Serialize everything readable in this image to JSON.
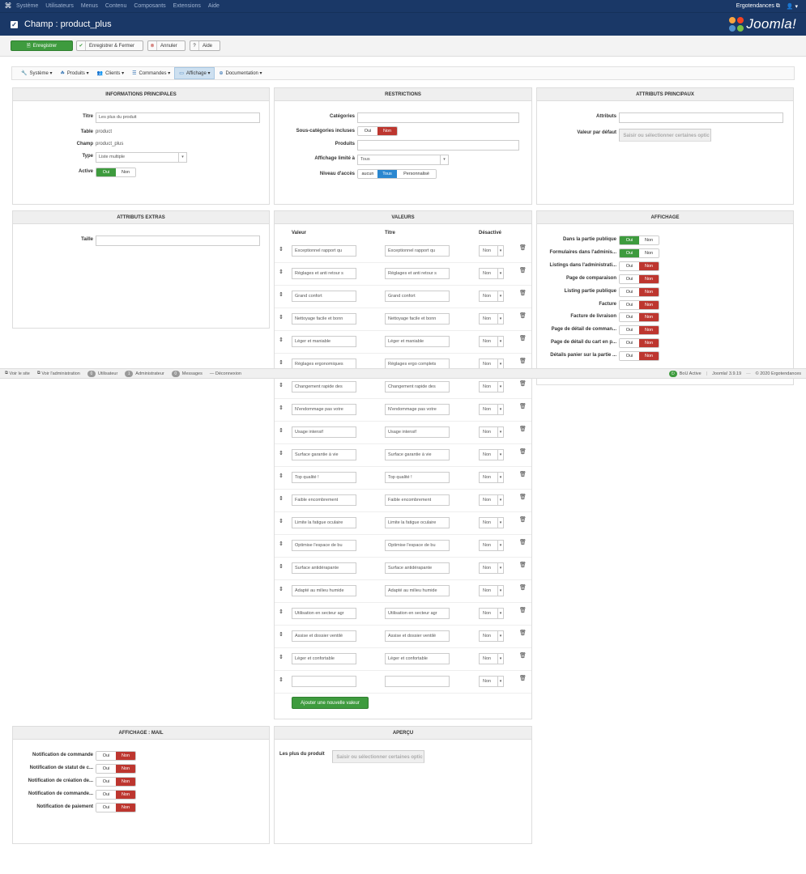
{
  "topnav": {
    "logo": "⌘",
    "items": [
      "Système",
      "Utilisateurs",
      "Menus",
      "Contenu",
      "Composants",
      "Extensions",
      "Aide"
    ],
    "site": "Ergotendances ⧉",
    "user": "👤 ▾"
  },
  "header": {
    "title": "Champ : product_plus",
    "brand": "Joomla!"
  },
  "toolbar": {
    "save": "Enregistrer",
    "save_close": "Enregistrer & Fermer",
    "cancel": "Annuler",
    "help": "Aide"
  },
  "menubar": [
    {
      "icon": "🔧",
      "label": "Système ▾"
    },
    {
      "icon": "☘",
      "label": "Produits ▾"
    },
    {
      "icon": "👥",
      "label": "Clients ▾"
    },
    {
      "icon": "☰",
      "label": "Commandes ▾"
    },
    {
      "icon": "▭",
      "label": "Affichage ▾"
    },
    {
      "icon": "⊕",
      "label": "Documentation ▾"
    }
  ],
  "info": {
    "heading": "INFORMATIONS PRINCIPALES",
    "titre_label": "Titre",
    "titre_value": "Les plus du produit",
    "table_label": "Table",
    "table_value": "product",
    "champ_label": "Champ",
    "champ_value": "product_plus",
    "type_label": "Type",
    "type_value": "Liste multiple",
    "active_label": "Active",
    "oui": "Oui",
    "non": "Non"
  },
  "restrictions": {
    "heading": "RESTRICTIONS",
    "categories_label": "Catégories",
    "subcat_label": "Sous-catégories incluses",
    "produits_label": "Produits",
    "affichage_label": "Affichage limité à",
    "affichage_value": "Tous",
    "niveau_label": "Niveau d'accès",
    "niveau_opts": [
      "aucun",
      "Tous",
      "Personnalisé"
    ],
    "oui": "Oui",
    "non": "Non"
  },
  "attributs": {
    "heading": "ATTRIBUTS PRINCIPAUX",
    "attributs_label": "Attributs",
    "defaut_label": "Valeur par défaut",
    "defaut_placeholder": "Saisir ou sélectionner certaines optic"
  },
  "extras": {
    "heading": "ATTRIBUTS EXTRAS",
    "taille_label": "Taille"
  },
  "valeurs": {
    "heading": "VALEURS",
    "col_valeur": "Valeur",
    "col_titre": "Titre",
    "col_desactive": "Désactivé",
    "non": "Non",
    "add_button": "Ajouter une nouvelle valeur",
    "rows": [
      [
        "Exceptionnel rapport qu",
        "Exceptionnel rapport qu"
      ],
      [
        "Réglages et anti retour s",
        "Réglages et anti retour s"
      ],
      [
        "Grand confort",
        "Grand confort"
      ],
      [
        "Nettoyage facile et bonn",
        "Nettoyage facile et bonn"
      ],
      [
        "Léger et maniable",
        "Léger et maniable"
      ],
      [
        "Réglages ergonomiques",
        "Réglages ergo complets"
      ],
      [
        "Changement rapide des",
        "Changement rapide des"
      ],
      [
        "N'endommage pas votre",
        "N'endommage pas votre"
      ],
      [
        "Usage intensif",
        "Usage intensif"
      ],
      [
        "Surface garantie à vie",
        "Surface garantie à vie"
      ],
      [
        "Top qualité !",
        "Top qualité !"
      ],
      [
        "Faible encombrement",
        "Faible encombrement"
      ],
      [
        "Limite la fatigue oculaire",
        "Limite la fatigue oculaire"
      ],
      [
        "Optimise l'espace de bu",
        "Optimise l'espace de bu"
      ],
      [
        "Surface antidérapante",
        "Surface antidérapante"
      ],
      [
        "Adapté au milieu humide",
        "Adapté au milieu humide"
      ],
      [
        "Utilisation en secteur agr",
        "Utilisation en secteur agr"
      ],
      [
        "Assise et dossier ventilé",
        "Assise et dossier ventilé"
      ],
      [
        "Léger et confortable",
        "Léger et confortable"
      ],
      [
        "",
        ""
      ]
    ]
  },
  "affichage": {
    "heading": "AFFICHAGE",
    "oui": "Oui",
    "non": "Non",
    "rows": [
      {
        "label": "Dans la partie publique",
        "state": "oui"
      },
      {
        "label": "Formulaires dans l'adminis...",
        "state": "oui"
      },
      {
        "label": "Listings dans l'administrati...",
        "state": "non"
      },
      {
        "label": "Page de comparaison",
        "state": "non"
      },
      {
        "label": "Listing partie publique",
        "state": "non"
      },
      {
        "label": "Facture",
        "state": "non"
      },
      {
        "label": "Facture de livraison",
        "state": "non"
      },
      {
        "label": "Page de détail de comman...",
        "state": "non"
      },
      {
        "label": "Page de détail du cart en p...",
        "state": "non"
      },
      {
        "label": "Détails panier sur la partie ...",
        "state": "non"
      }
    ]
  },
  "mail": {
    "heading": "AFFICHAGE : MAIL",
    "oui": "Oui",
    "non": "Non",
    "rows": [
      "Notification de commande",
      "Notification de statut de c...",
      "Notification de création de...",
      "Notification de commande...",
      "Notification de paiement"
    ]
  },
  "apercu": {
    "heading": "APERÇU",
    "label": "Les plus du produit",
    "placeholder": "Saisir ou sélectionner certaines optic"
  },
  "status": {
    "voir_site": "Voir le site",
    "voir_admin": "Voir l'administration",
    "visitors_count": "0",
    "visitors": "Utilisateur",
    "admins_count": "1",
    "admins": "Administrateur",
    "messages_count": "0",
    "messages": "Messages",
    "logout": "Déconnexion",
    "bou": "BoU Active",
    "version": "Joomla! 3.9.19",
    "copyright": "© 2020 Ergotendances"
  }
}
